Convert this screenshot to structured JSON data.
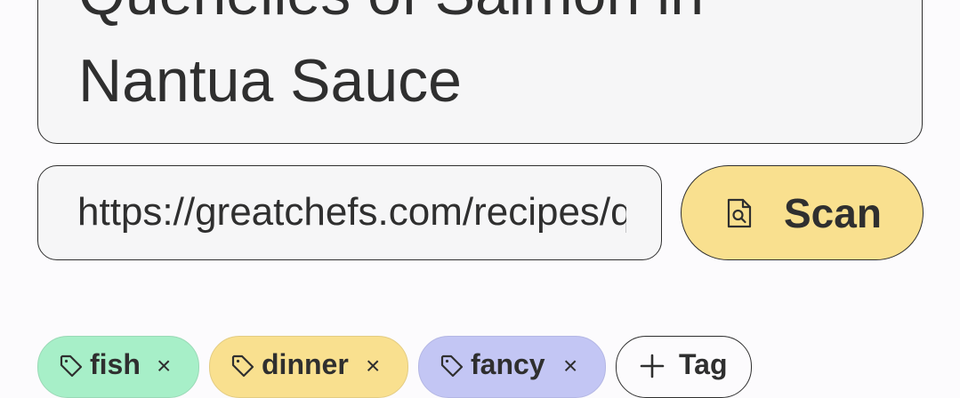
{
  "recipe": {
    "title": "Quenelles of Salmon in Nantua Sauce"
  },
  "url_field": {
    "value": "https://greatchefs.com/recipes/quenelles-of-salmon-in-nantua-sauce"
  },
  "scan_button": {
    "label": "Scan",
    "icon": "document-search-icon",
    "color": "#f9e08f"
  },
  "tags": [
    {
      "label": "fish",
      "color": "#a7efc8",
      "icon": "tag-icon",
      "remove": "×"
    },
    {
      "label": "dinner",
      "color": "#f9e08f",
      "icon": "tag-icon",
      "remove": "×"
    },
    {
      "label": "fancy",
      "color": "#c3c6f4",
      "icon": "tag-icon",
      "remove": "×"
    }
  ],
  "add_tag_button": {
    "label": "Tag",
    "icon": "plus-icon"
  }
}
